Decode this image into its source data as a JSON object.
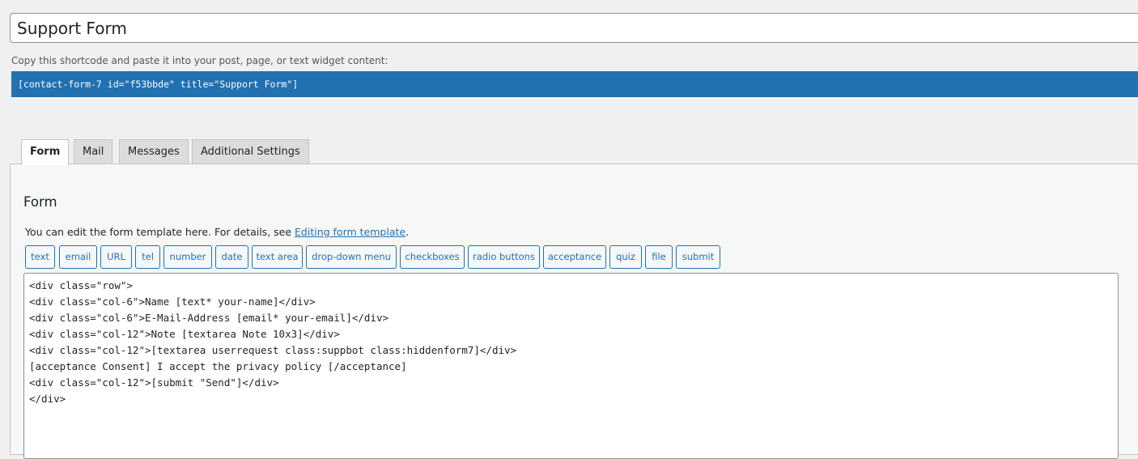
{
  "form_title": "Support Form",
  "shortcode": {
    "label": "Copy this shortcode and paste it into your post, page, or text widget content:",
    "value": "[contact-form-7 id=\"f53bbde\" title=\"Support Form\"]"
  },
  "tabs": [
    {
      "label": "Form",
      "active": true
    },
    {
      "label": "Mail",
      "active": false
    },
    {
      "label": "Messages",
      "active": false
    },
    {
      "label": "Additional Settings",
      "active": false
    }
  ],
  "panel": {
    "title": "Form",
    "description_prefix": "You can edit the form template here. For details, see ",
    "description_link": "Editing form template",
    "description_suffix": "."
  },
  "tag_buttons": [
    "text",
    "email",
    "URL",
    "tel",
    "number",
    "date",
    "text area",
    "drop-down menu",
    "checkboxes",
    "radio buttons",
    "acceptance",
    "quiz",
    "file",
    "submit"
  ],
  "editor_lines": [
    "<div class=\"row\">",
    "<div class=\"col-6\">Name [text* your-name]</div>",
    "<div class=\"col-6\">E-Mail-Address [email* your-email]</div>",
    "<div class=\"col-12\">Note [textarea Note 10x3]</div>",
    "<div class=\"col-12\">[textarea userrequest class:suppbot class:hiddenform7]</div>",
    "[acceptance Consent] I accept the privacy policy [/acceptance]",
    "<div class=\"col-12\">[submit \"Send\"]</div>",
    "</div>"
  ],
  "colors": {
    "accent": "#2271b1",
    "background": "#f0f0f1",
    "border": "#c3c4c7"
  }
}
